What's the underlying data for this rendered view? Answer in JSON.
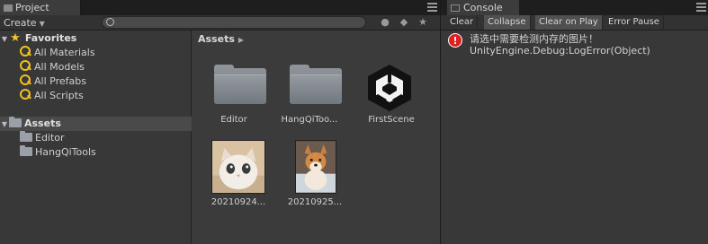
{
  "project": {
    "tab_title": "Project",
    "create_label": "Create",
    "search_placeholder": "",
    "favorites": {
      "header": "Favorites",
      "items": [
        "All Materials",
        "All Models",
        "All Prefabs",
        "All Scripts"
      ]
    },
    "assets_tree": {
      "header": "Assets",
      "children": [
        "Editor",
        "HangQiTools"
      ]
    },
    "breadcrumb": "Assets",
    "grid": [
      {
        "label": "Editor",
        "kind": "folder-icon"
      },
      {
        "label": "HangQiToo...",
        "kind": "folder-icon"
      },
      {
        "label": "FirstScene",
        "kind": "unity-scene-icon"
      },
      {
        "label": "20210924...",
        "kind": "cat-photo-thumbnail"
      },
      {
        "label": "20210925...",
        "kind": "dog-photo-thumbnail"
      }
    ]
  },
  "console": {
    "tab_title": "Console",
    "buttons": [
      "Clear",
      "Collapse",
      "Clear on Play",
      "Error Pause"
    ],
    "active_buttons": [
      "Collapse",
      "Clear on Play"
    ],
    "log": {
      "level": "error",
      "icon": "!",
      "line1": "请选中需要检测内存的图片！",
      "line2": "UnityEngine.Debug:LogError(Object)"
    }
  },
  "colors": {
    "favorites_star": "#f1c232",
    "error_icon": "#e0201c",
    "selection": "#4a4a4a"
  }
}
